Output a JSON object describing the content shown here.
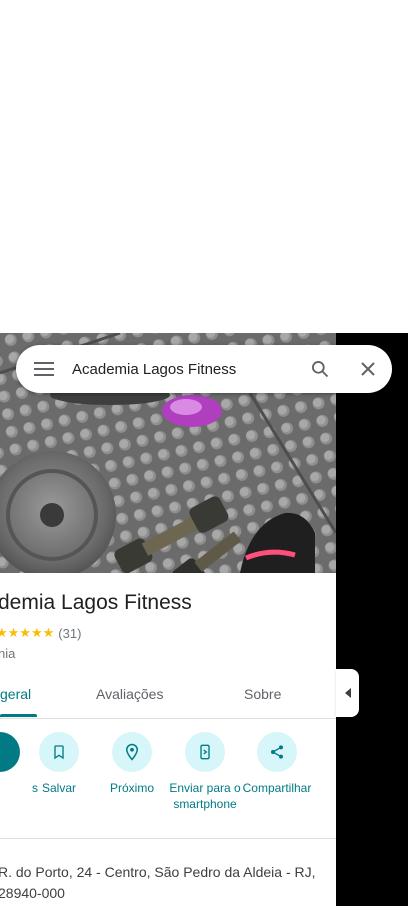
{
  "search": {
    "query": "Academia Lagos Fitness"
  },
  "place": {
    "name": "Academia Lagos Fitness",
    "name_visible": "demia Lagos Fitness",
    "stars": "★★★★★",
    "rating_count": "(31)",
    "category": "nia"
  },
  "tabs": [
    {
      "label": "geral",
      "active": true
    },
    {
      "label": "Avaliações",
      "active": false
    },
    {
      "label": "Sobre",
      "active": false
    }
  ],
  "actions": [
    {
      "label": "s",
      "icon": "directions-icon"
    },
    {
      "label": "Salvar",
      "icon": "bookmark-icon"
    },
    {
      "label": "Próximo",
      "icon": "nearby-icon"
    },
    {
      "label": "Enviar para o smartphone",
      "icon": "send-to-phone-icon"
    },
    {
      "label": "Compartilhar",
      "icon": "share-icon"
    }
  ],
  "address": "R. do Porto, 24 - Centro, São Pedro da Aldeia - RJ, 28940-000",
  "colors": {
    "accent": "#007b83",
    "action_bg": "#d7f6f9",
    "star": "#fbbc04"
  }
}
